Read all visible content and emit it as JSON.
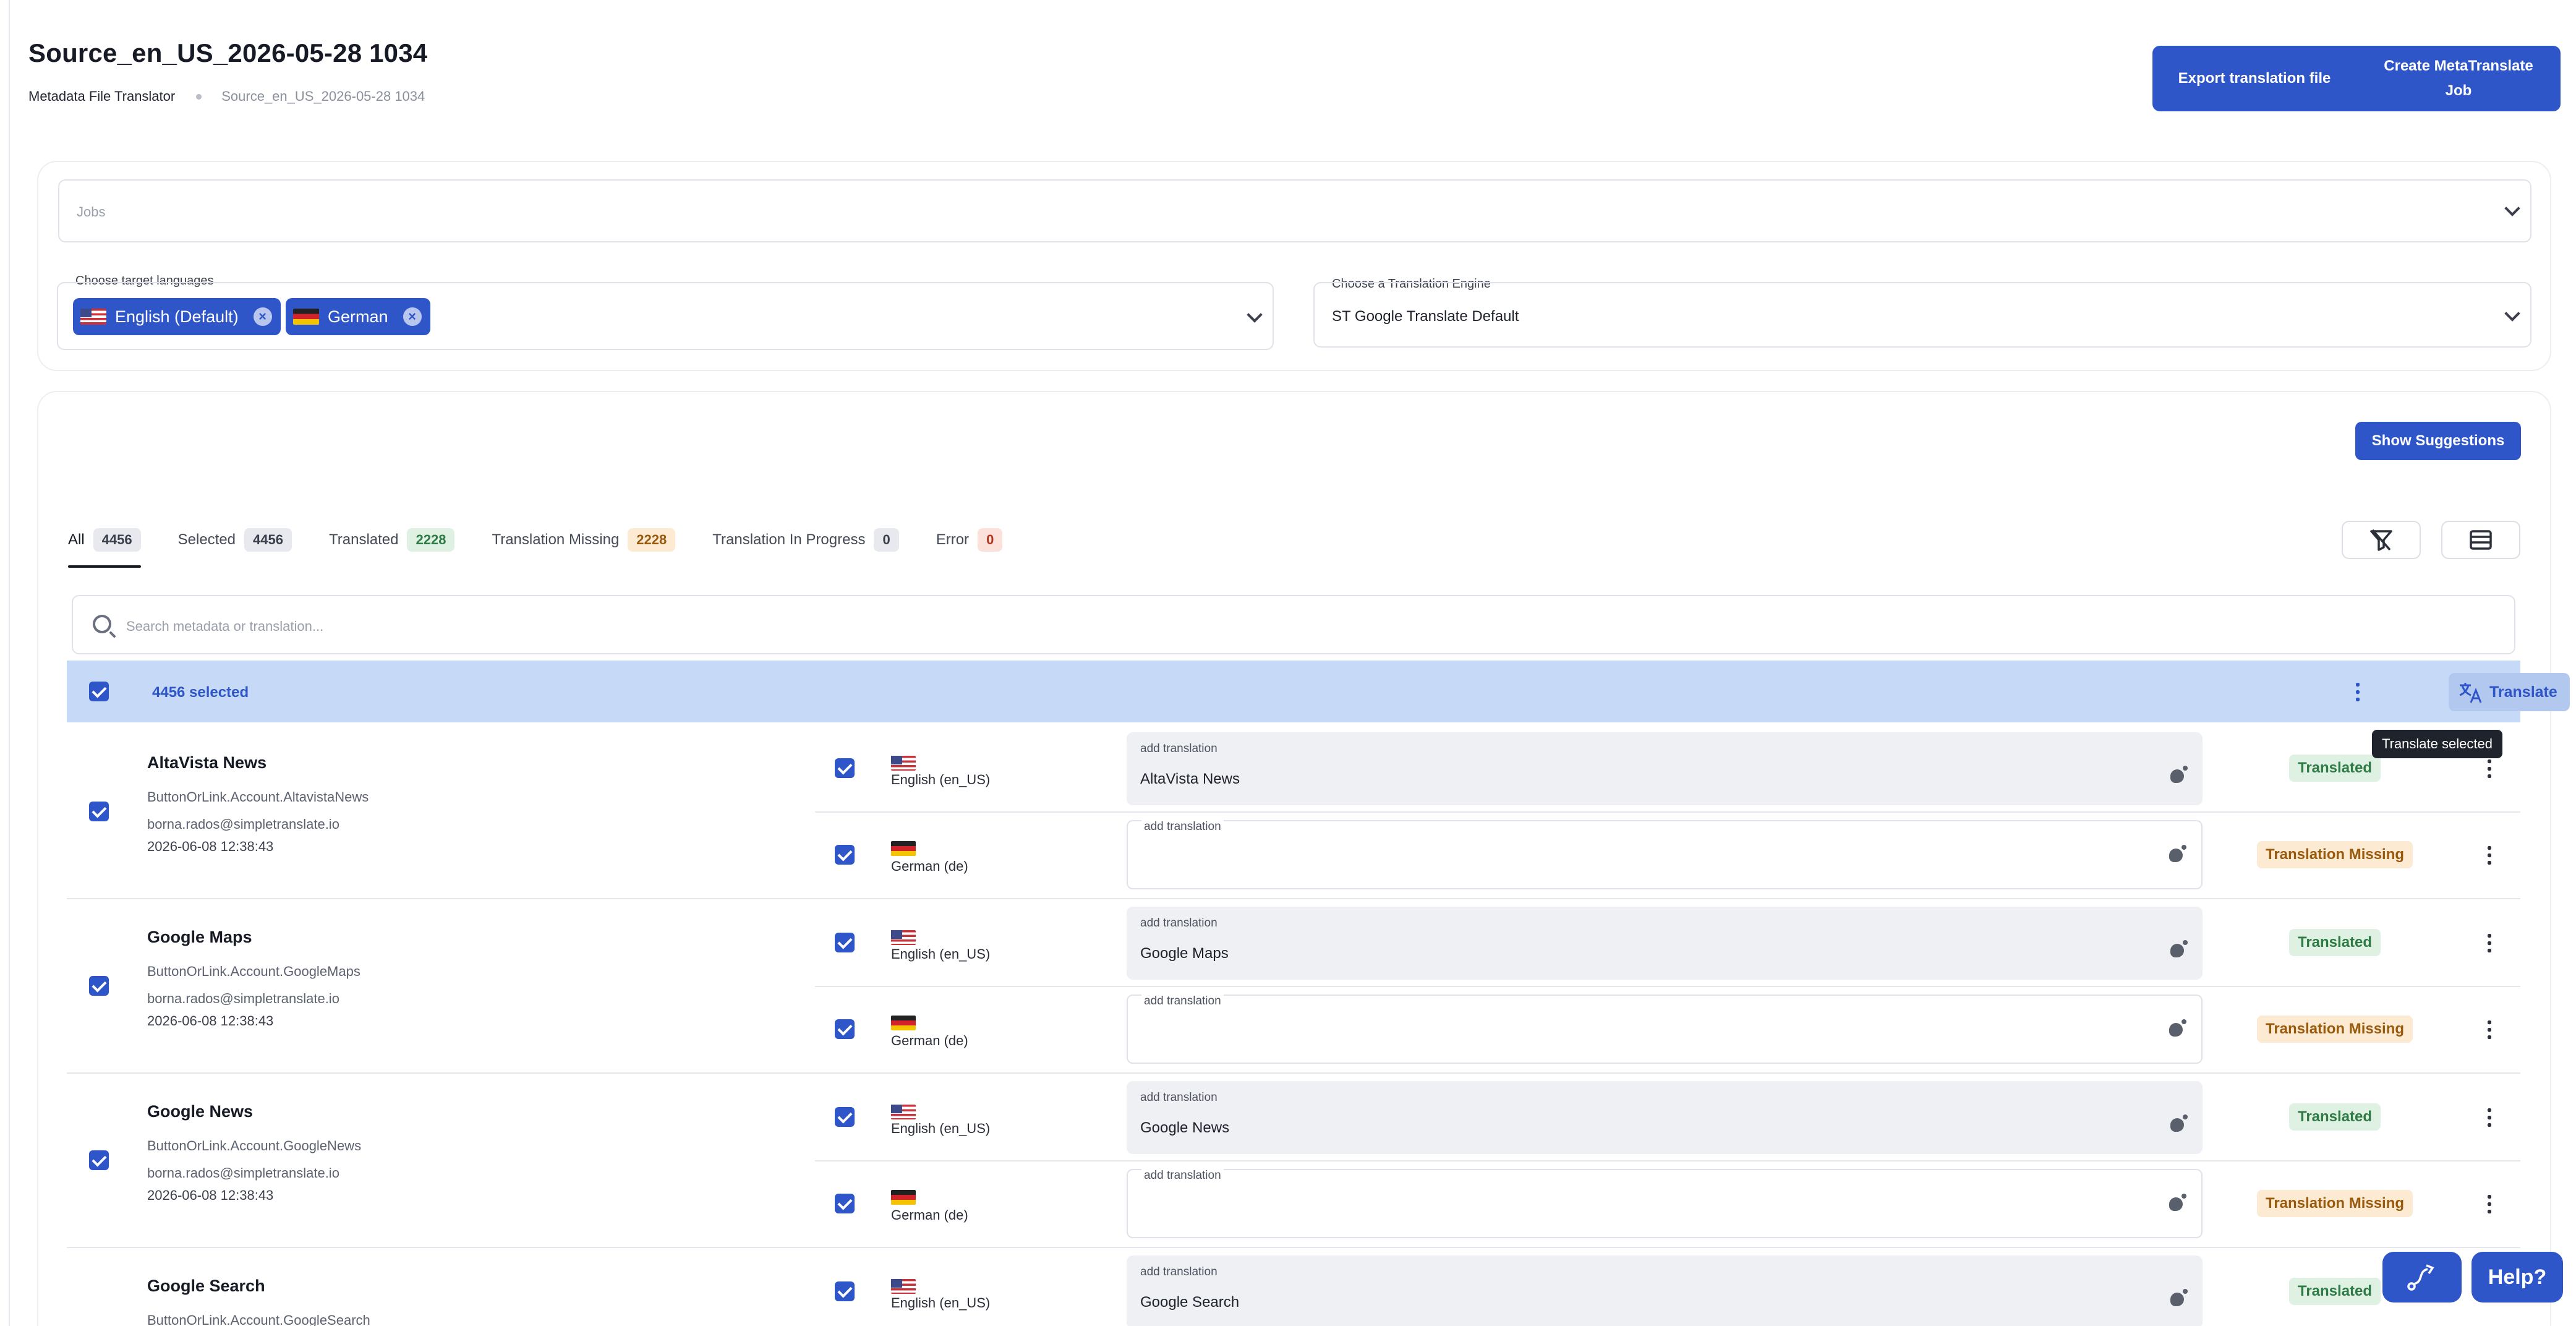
{
  "header": {
    "title": "Source_en_US_2026-05-28 1034",
    "breadcrumb": [
      "Metadata File Translator",
      "Source_en_US_2026-05-28 1034"
    ],
    "export_label": "Export translation file",
    "create_label": "Create MetaTranslate Job"
  },
  "filters": {
    "jobs_placeholder": "Jobs",
    "languages_label": "Choose target languages",
    "languages": [
      {
        "label": "English (Default)",
        "flag": "flag-us-icon"
      },
      {
        "label": "German",
        "flag": "flag-de-icon"
      }
    ],
    "engine_label": "Choose a Translation Engine",
    "engine_value": "ST Google Translate Default"
  },
  "suggestions_label": "Show Suggestions",
  "tabs": [
    {
      "label": "All",
      "count": "4456",
      "badge": "gray",
      "active": true
    },
    {
      "label": "Selected",
      "count": "4456",
      "badge": "gray"
    },
    {
      "label": "Translated",
      "count": "2228",
      "badge": "green"
    },
    {
      "label": "Translation Missing",
      "count": "2228",
      "badge": "orange"
    },
    {
      "label": "Translation In Progress",
      "count": "0",
      "badge": "gray"
    },
    {
      "label": "Error",
      "count": "0",
      "badge": "red"
    }
  ],
  "search_placeholder": "Search metadata or translation...",
  "selection": {
    "count_label": "4456 selected",
    "translate_label": "Translate",
    "tooltip": "Translate selected"
  },
  "rows": [
    {
      "title": "AltaVista News",
      "key": "ButtonOrLink.Account.AltavistaNews",
      "user": "borna.rados@simpletranslate.io",
      "date": "2026-06-08 12:38:43",
      "langs": [
        {
          "name": "English (en_US)",
          "flag": "flag-us-icon",
          "box_label": "add translation",
          "text": "AltaVista News",
          "status": "Translated"
        },
        {
          "name": "German (de)",
          "flag": "flag-de-icon",
          "box_label": "add translation",
          "text": "",
          "status": "Translation Missing"
        }
      ]
    },
    {
      "title": "Google Maps",
      "key": "ButtonOrLink.Account.GoogleMaps",
      "user": "borna.rados@simpletranslate.io",
      "date": "2026-06-08 12:38:43",
      "langs": [
        {
          "name": "English (en_US)",
          "flag": "flag-us-icon",
          "box_label": "add translation",
          "text": "Google Maps",
          "status": "Translated"
        },
        {
          "name": "German (de)",
          "flag": "flag-de-icon",
          "box_label": "add translation",
          "text": "",
          "status": "Translation Missing"
        }
      ]
    },
    {
      "title": "Google News",
      "key": "ButtonOrLink.Account.GoogleNews",
      "user": "borna.rados@simpletranslate.io",
      "date": "2026-06-08 12:38:43",
      "langs": [
        {
          "name": "English (en_US)",
          "flag": "flag-us-icon",
          "box_label": "add translation",
          "text": "Google News",
          "status": "Translated"
        },
        {
          "name": "German (de)",
          "flag": "flag-de-icon",
          "box_label": "add translation",
          "text": "",
          "status": "Translation Missing"
        }
      ]
    },
    {
      "title": "Google Search",
      "key": "ButtonOrLink.Account.GoogleSearch",
      "user": "",
      "date": "",
      "langs": [
        {
          "name": "English (en_US)",
          "flag": "flag-us-icon",
          "box_label": "add translation",
          "text": "Google Search",
          "status": "Translated"
        }
      ]
    }
  ],
  "fab": {
    "help_label": "Help?"
  },
  "colors": {
    "accent": "#2f56c9",
    "selection_bar": "#c6daf7",
    "translated": "#2f7b45",
    "missing": "#9a5a0d"
  }
}
